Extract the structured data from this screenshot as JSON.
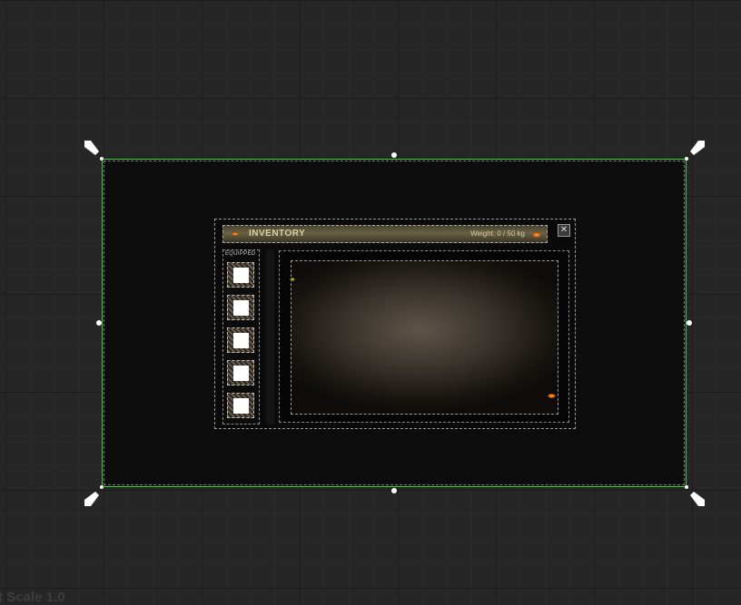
{
  "inventory": {
    "title": "INVENTORY",
    "weight": "Weight: 0 / 50 kg",
    "close_symbol": "✕",
    "equipped_label": "EQUIPPED",
    "slot_count": 5
  },
  "viewport": {
    "scale_label": "ıt Scale 1.0"
  },
  "colors": {
    "selection_outline": "#3ad13a",
    "background": "#262626"
  }
}
